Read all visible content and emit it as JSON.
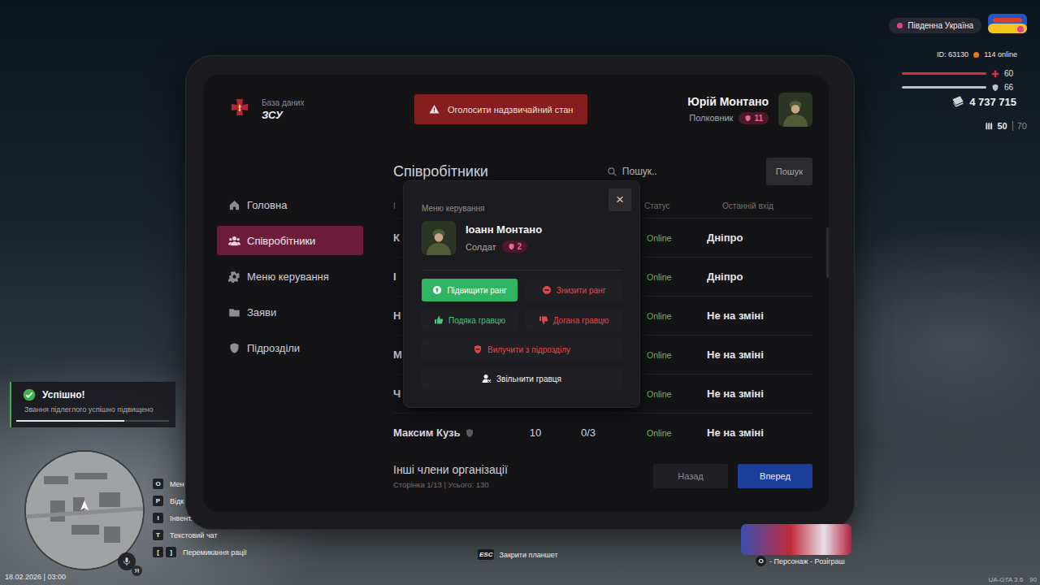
{
  "game": {
    "date_time": "18.02.2026 | 03:00",
    "version": "UA-GTA 3.6",
    "fps": "90",
    "voice_key": "Я"
  },
  "hud": {
    "server": "Південна Україна",
    "player_id": "ID: 63130",
    "online": "114 online",
    "health": {
      "reading": "60",
      "level": 1
    },
    "armor": {
      "reading": "66",
      "level": 1
    },
    "money": "4 737 715",
    "ammo": {
      "clip": "50",
      "reserve": "70"
    }
  },
  "toast": {
    "title": "Успішно!",
    "message": "Звання підлеглого успішно підвищено",
    "level": 0.71
  },
  "key_hints": [
    {
      "keys": [
        "O"
      ],
      "label": "Мен"
    },
    {
      "keys": [
        "P"
      ],
      "label": "Відк"
    },
    {
      "keys": [
        "I"
      ],
      "label": "Інвент."
    },
    {
      "keys": [
        "T"
      ],
      "label": "Текстовий чат"
    },
    {
      "keys": [
        "[",
        "]"
      ],
      "label": "Перемикання рації"
    }
  ],
  "tablet_hint": {
    "key": "ESC",
    "label": "Закрити планшет"
  },
  "promo": {
    "key": "O",
    "label": "- Персонаж - Розіграш"
  },
  "tablet": {
    "org": {
      "caption": "База даних",
      "name": "ЗСУ"
    },
    "emergency_button": "Оголосити надзвичайний стан",
    "user": {
      "name": "Юрій Монтано",
      "rank": "Полковник",
      "rank_level": "11"
    },
    "sidebar": [
      {
        "label": "Головна",
        "selected": false
      },
      {
        "label": "Співробітники",
        "selected": true
      },
      {
        "label": "Меню керування",
        "selected": false
      },
      {
        "label": "Заяви",
        "selected": false
      },
      {
        "label": "Підрозділи",
        "selected": false
      }
    ],
    "section_title": "Співробітники",
    "search": {
      "placeholder": "Пошук..",
      "button": "Пошук"
    },
    "table": {
      "header": {
        "name": "І",
        "status": "Статус",
        "last_login": "Останній вхід"
      },
      "rows": [
        {
          "name": "К",
          "badge": false,
          "status": "Online",
          "last_login": "Дніпро"
        },
        {
          "name": "І",
          "badge": false,
          "status": "Online",
          "last_login": "Дніпро"
        },
        {
          "name": "Н",
          "badge": false,
          "status": "Online",
          "last_login": "Не на зміні"
        },
        {
          "name": "М",
          "badge": false,
          "status": "Online",
          "last_login": "Не на зміні"
        },
        {
          "name": "Ч",
          "badge": false,
          "status": "Online",
          "last_login": "Не на зміні"
        },
        {
          "name": "Максим Кузь",
          "badge": true,
          "rank": "10",
          "warnings": "0/3",
          "status": "Online",
          "last_login": "Не на зміні"
        }
      ]
    },
    "footer": {
      "title": "Інші члени організації",
      "pagination": "Сторінка 1/13 | Усього: 130",
      "prev": "Назад",
      "next": "Вперед"
    },
    "modal": {
      "caption": "Меню керування",
      "close": "×",
      "player": {
        "name": "Іоанн Монтано",
        "rank": "Солдат",
        "rank_level": "2"
      },
      "actions": [
        {
          "label": "Підвищити ранг",
          "kind": "filled",
          "color": "#2fb561"
        },
        {
          "label": "Знизити ранг",
          "kind": "plain",
          "color": "#e0474c"
        },
        {
          "label": "Подяка гравцю",
          "kind": "plain",
          "color": "#4ec27a"
        },
        {
          "label": "Догана гравцю",
          "kind": "plain",
          "color": "#e0474c"
        },
        {
          "label": "Вилучити з підрозділу",
          "kind": "wide",
          "color": "#e0474c"
        },
        {
          "label": "Звільнити гравця",
          "kind": "wide",
          "color": "#f2f2f4"
        }
      ]
    }
  }
}
